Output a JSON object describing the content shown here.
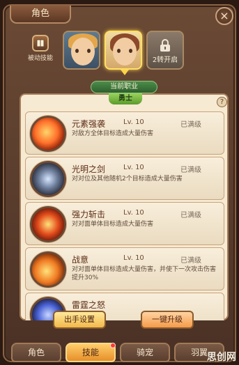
{
  "window": {
    "title": "角色",
    "close": "×"
  },
  "passive_skill": {
    "label": "被动技能",
    "icon": "book-icon"
  },
  "portraits": {
    "locked_text": "2转开启"
  },
  "current_job": {
    "label": "当前职业",
    "name": "勇士"
  },
  "help": "?",
  "skills": [
    {
      "name": "元素强袭",
      "level": "Lv. 10",
      "status": "已满级",
      "desc": "对敌方全体目标造成大量伤害"
    },
    {
      "name": "光明之剑",
      "level": "Lv. 10",
      "status": "已满级",
      "desc": "对对位及其他随机2个目标造成大量伤害"
    },
    {
      "name": "强力斩击",
      "level": "Lv. 10",
      "status": "已满级",
      "desc": "对对面单体目标造成大量伤害"
    },
    {
      "name": "战意",
      "level": "Lv. 10",
      "status": "已满级",
      "desc": "对对面单体目标造成大量伤害，并使下一次攻击伤害提升30%"
    },
    {
      "name": "雷霆之怒",
      "level": "",
      "status": "",
      "desc": ""
    }
  ],
  "buttons": {
    "setting": "出手设置",
    "upgrade": "一键升级"
  },
  "tabs": [
    "角色",
    "技能",
    "骑宠",
    "羽翼"
  ],
  "watermark": "思创网",
  "colors": {
    "frame": "#6b4a35",
    "panel": "#f6ead3",
    "active_tab": "#e68f2a"
  }
}
